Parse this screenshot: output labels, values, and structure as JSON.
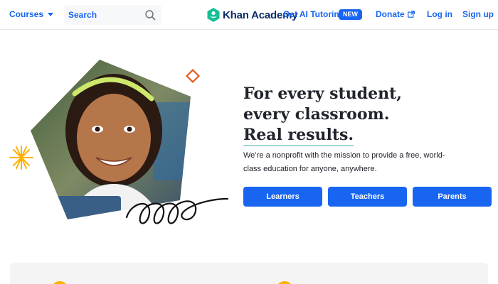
{
  "header": {
    "courses_label": "Courses",
    "search_placeholder": "Search",
    "logo_text": "Khan Academy",
    "ai_tutoring_label": "Get AI Tutoring",
    "new_badge": "NEW",
    "donate_label": "Donate",
    "login_label": "Log in",
    "signup_label": "Sign up"
  },
  "hero": {
    "headline_line1": "For every student,",
    "headline_line2": "every classroom.",
    "headline_line3": "Real results.",
    "subtext": "We’re a nonprofit with the mission to provide a free, world-class education for anyone, anywhere.",
    "buttons": {
      "learners": "Learners",
      "teachers": "Teachers",
      "parents": "Parents"
    }
  },
  "colors": {
    "accent": "#1865f2",
    "brand_green": "#14bf96",
    "navy": "#0a2a66",
    "underline": "#9fd6d2",
    "sunburst": "#ffb100",
    "diamond": "#e35c20"
  },
  "icons": {
    "search": "magnifier-icon",
    "donate": "external-link-icon",
    "logo": "hexagon-logo-icon",
    "courses": "caret-down-icon"
  }
}
